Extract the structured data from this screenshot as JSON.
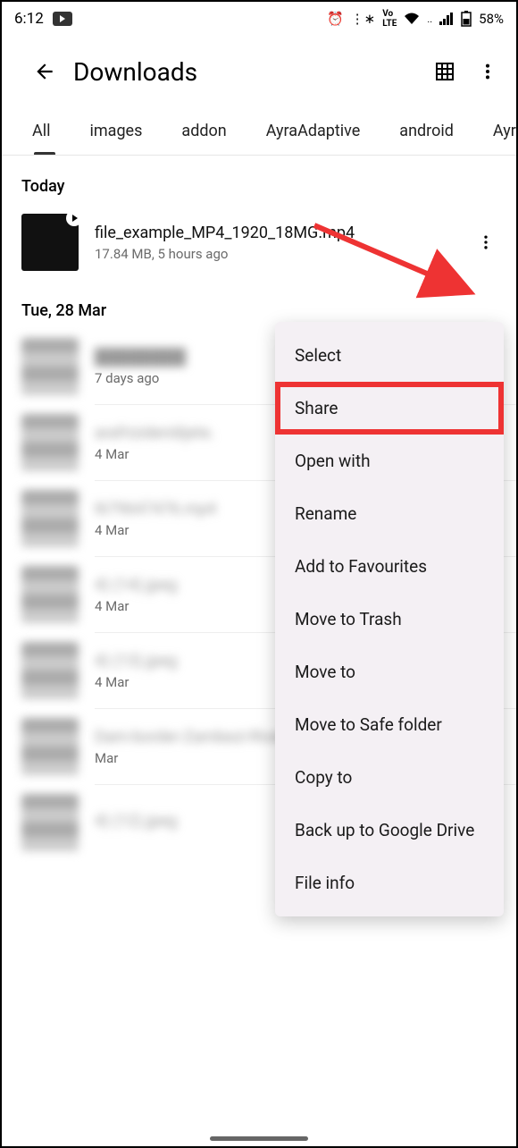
{
  "statusbar": {
    "time": "6:12",
    "battery": "58%"
  },
  "appbar": {
    "title": "Downloads"
  },
  "tabs": [
    "All",
    "images",
    "addon",
    "AyraAdaptive",
    "android",
    "AyraLa"
  ],
  "sections": [
    {
      "header": "Today",
      "files": [
        {
          "name": "file_example_MP4_1920_18MG.mp4",
          "meta": "17.84 MB, 5 hours ago",
          "video": true
        }
      ]
    },
    {
      "header": "Tue, 28 Mar",
      "files": [
        {
          "name": "████████",
          "meta": "7 days ago",
          "blur": true
        },
        {
          "name": "arafrizideridijete.",
          "meta": "4 Mar",
          "blur": true
        },
        {
          "name": "l679647476.mp4",
          "meta": "4 Mar",
          "blur": true
        },
        {
          "name": "4) (14).jpeg",
          "meta": "4 Mar",
          "blur": true
        },
        {
          "name": "4) (13).jpeg",
          "meta": "4 Mar",
          "blur": true
        },
        {
          "name": "Dam-border-Zambezi-River-Zimbabwe..",
          "meta": "Mar",
          "blur": true
        },
        {
          "name": "4) (12).jpeg",
          "meta": "",
          "blur": true
        }
      ]
    }
  ],
  "menu": {
    "items": [
      "Select",
      "Share",
      "Open with",
      "Rename",
      "Add to Favourites",
      "Move to Trash",
      "Move to",
      "Move to Safe folder",
      "Copy to",
      "Back up to Google Drive",
      "File info"
    ],
    "highlight": "Share"
  }
}
